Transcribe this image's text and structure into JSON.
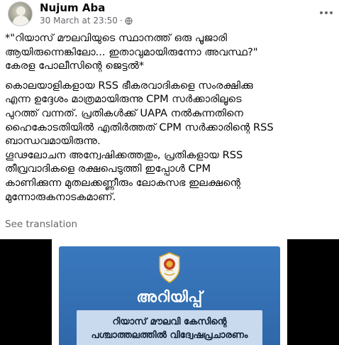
{
  "post": {
    "author": "Nujum Aba",
    "timestamp": "30 March at 23:50",
    "separator": "·",
    "privacy_icon": "globe-icon",
    "more_icon": "more-options-icon",
    "lines_para1": [
      "*\"റിയാസ് മൗലവിയുടെ സ്ഥാനത്ത് ഒരു പൂജാരി",
      "ആയിരുന്നെങ്കിലോ... ഇതാവുമായിരുന്നോ അവസ്ഥ?\"",
      "കേരള പോലീസിന്റെ ജെട്ടൽ*"
    ],
    "lines_para2": [
      "കൊലയാളികളായ RSS ഭീകരവാദികളെ സംരക്ഷിക്കു",
      "എന്ന ഉദ്ദേശം മാത്രമായിരുന്നു CPM സർക്കാരിലൂടെ",
      "പുറത്ത് വന്നത്. പ്രതികൾക്ക് UAPA നൽകുന്നതിനെ",
      "ഹൈകോടതിയിൽ എതിർത്തത് CPM സർക്കാരിന്റെ RSS",
      "ബാന്ധവമായിരുന്നു.",
      "ഗൂഢലോചന അന്വേഷിക്കത്തതും, പ്രതികളായ RSS",
      "തീവ്രവാദികളെ രക്ഷപെടുത്തി ഇപ്പോൾ CPM",
      "കാണിക്കുന്ന മുതലക്കണ്ണീരും ലോകസഭ ഇലക്ഷന്റെ",
      "മുന്നോരുകനാടകമാണ്."
    ],
    "see_translation": "See translation"
  },
  "media": {
    "notice_title": "അറിയിപ്പ്",
    "notice_lines": [
      "റിയാസ് മൗലവി കേസിന്റെ",
      "പശ്ചാത്തലത്തിൽ വിദ്വേഷപ്രചാരണം"
    ],
    "emblem_icon": "kerala-police-emblem-icon",
    "colors": {
      "background": "#000000",
      "poster_blue": "#2f6db0",
      "box": "#c9d9ee"
    }
  }
}
